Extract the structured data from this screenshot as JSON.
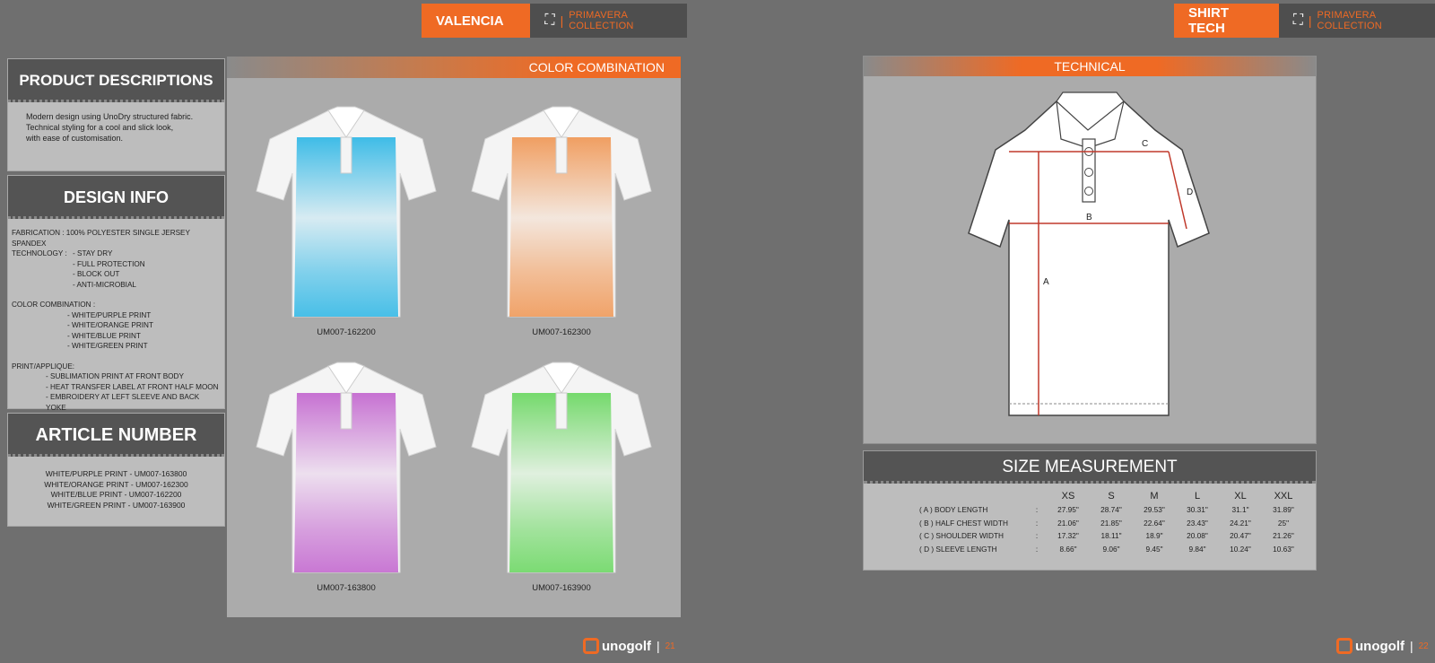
{
  "left_page": {
    "tab_title": "VALENCIA",
    "collection": "PRIMAVERA COLLECTION",
    "product_descriptions": {
      "heading": "PRODUCT DESCRIPTIONS",
      "lines": [
        "Modern design using UnoDry structured fabric.",
        "Technical styling for a cool and slick look,",
        "with ease of customisation."
      ]
    },
    "design_info": {
      "heading": "DESIGN INFO",
      "fabrication": "FABRICATION :   100% POLYESTER SINGLE JERSEY SPANDEX",
      "technology_label": "TECHNOLOGY :",
      "technology": [
        "- STAY DRY",
        "- FULL PROTECTION",
        "- BLOCK OUT",
        "- ANTI-MICROBIAL"
      ],
      "color_label": "COLOR COMBINATION :",
      "colors": [
        "- WHITE/PURPLE PRINT",
        "- WHITE/ORANGE PRINT",
        "- WHITE/BLUE PRINT",
        "- WHITE/GREEN PRINT"
      ],
      "print_label": "PRINT/APPLIQUE:",
      "prints": [
        "- SUBLIMATION PRINT AT FRONT BODY",
        "- HEAT TRANSFER LABEL AT FRONT HALF MOON",
        "- EMBROIDERY AT LEFT SLEEVE AND BACK YOKE"
      ]
    },
    "article_number": {
      "heading": "ARTICLE NUMBER",
      "lines": [
        "WHITE/PURPLE PRINT - UM007-163800",
        "WHITE/ORANGE PRINT - UM007-162300",
        "WHITE/BLUE PRINT - UM007-162200",
        "WHITE/GREEN PRINT - UM007-163900"
      ]
    },
    "color_combination": {
      "heading": "COLOR COMBINATION",
      "shirts": [
        {
          "code": "UM007-162200",
          "color": "#35b9e6"
        },
        {
          "code": "UM007-162300",
          "color": "#f09a5a"
        },
        {
          "code": "UM007-163800",
          "color": "#c46ad0"
        },
        {
          "code": "UM007-163900",
          "color": "#6ed865"
        }
      ]
    },
    "brand": "unogolf",
    "page_number": "21"
  },
  "right_page": {
    "tab_title": "SHIRT TECH",
    "collection": "PRIMAVERA COLLECTION",
    "technical_heading": "TECHNICAL",
    "diagram_labels": {
      "a": "A",
      "b": "B",
      "c": "C",
      "d": "D"
    },
    "size_measurement": {
      "heading": "SIZE MEASUREMENT",
      "sizes": [
        "XS",
        "S",
        "M",
        "L",
        "XL",
        "XXL"
      ],
      "rows": [
        {
          "label": "( A ) BODY LENGTH",
          "values": [
            "27.95\"",
            "28.74\"",
            "29.53\"",
            "30.31\"",
            "31.1\"",
            "31.89\""
          ]
        },
        {
          "label": "( B ) HALF CHEST WIDTH",
          "values": [
            "21.06\"",
            "21.85\"",
            "22.64\"",
            "23.43\"",
            "24.21\"",
            "25\""
          ]
        },
        {
          "label": "( C ) SHOULDER WIDTH",
          "values": [
            "17.32\"",
            "18.11\"",
            "18.9\"",
            "20.08\"",
            "20.47\"",
            "21.26\""
          ]
        },
        {
          "label": "( D ) SLEEVE LENGTH",
          "values": [
            "8.66\"",
            "9.06\"",
            "9.45\"",
            "9.84\"",
            "10.24\"",
            "10.63\""
          ]
        }
      ]
    },
    "brand": "unogolf",
    "page_number": "22"
  }
}
